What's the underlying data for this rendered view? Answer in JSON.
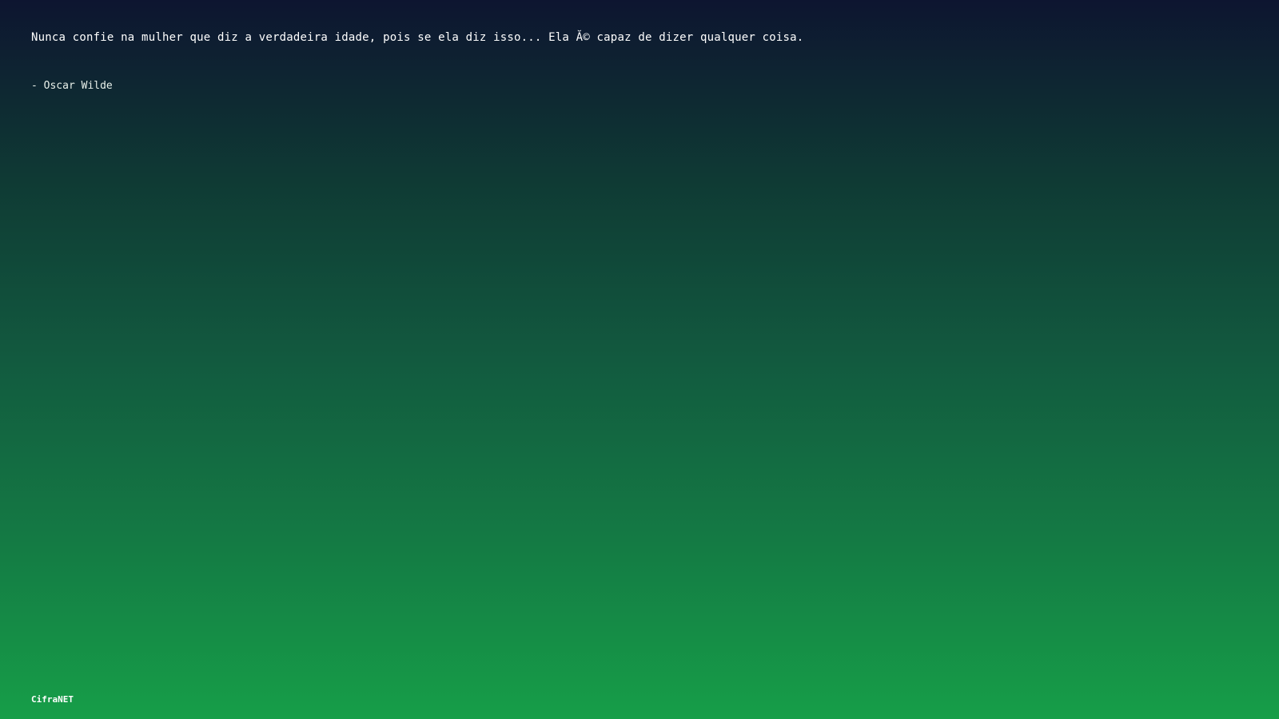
{
  "quote": {
    "text": "Nunca confie na mulher que diz a verdadeira idade, pois se ela diz isso... Ela Ă© capaz de dizer qualquer coisa.",
    "author": "- Oscar Wilde"
  },
  "footer": {
    "brand": "CifraNET"
  },
  "colors": {
    "gradient_top": "#0d1530",
    "gradient_bottom": "#169e48",
    "text": "#ffffff"
  }
}
